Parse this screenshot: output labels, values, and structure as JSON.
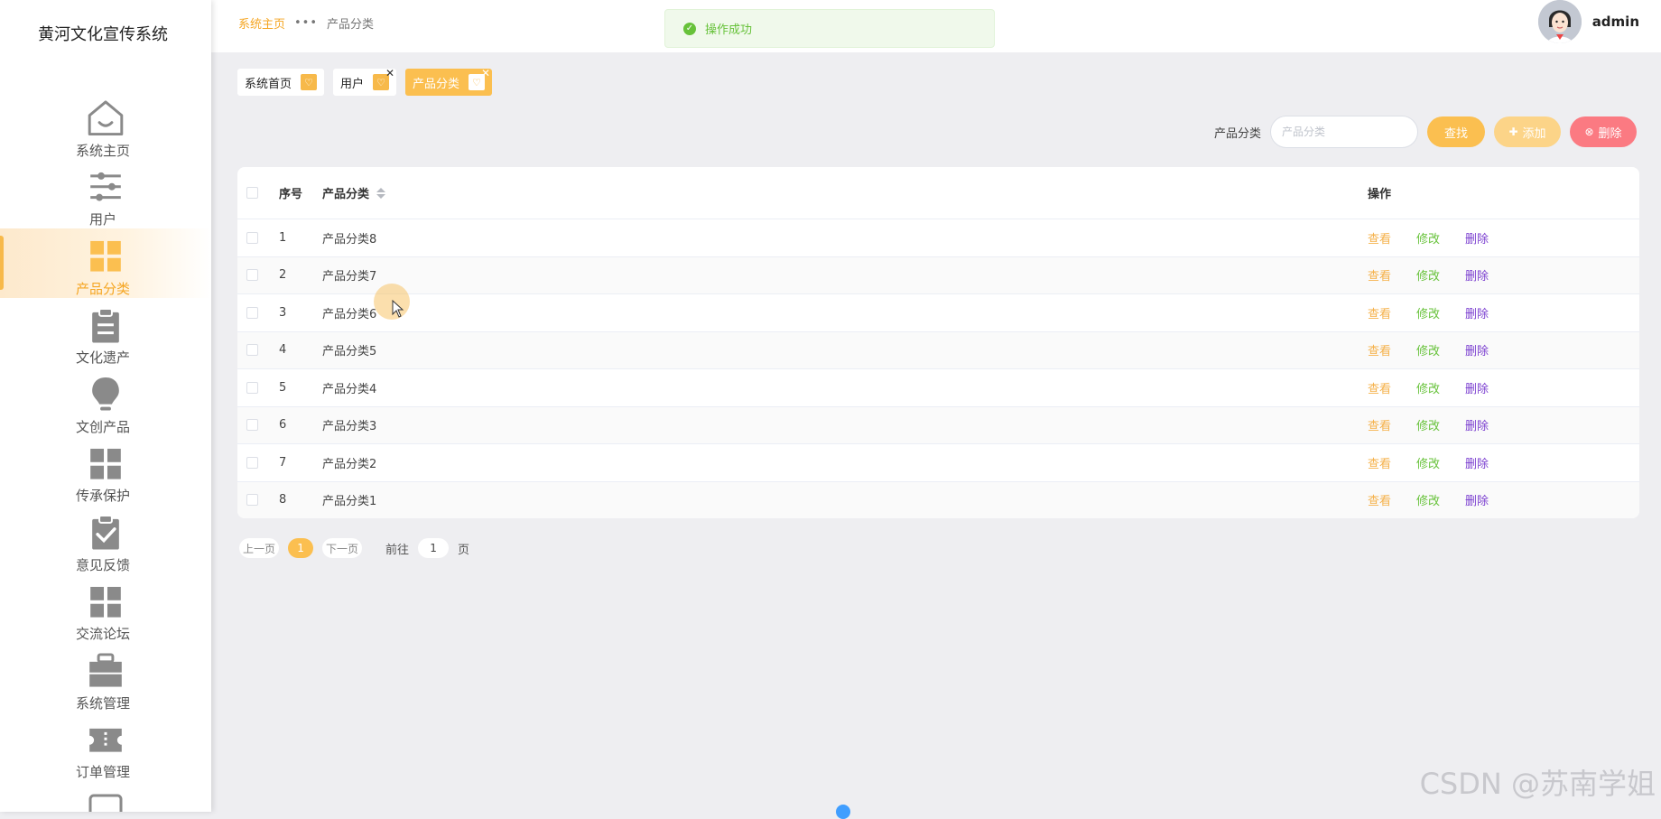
{
  "app": {
    "title": "黄河文化宣传系统"
  },
  "sidebar": {
    "items": [
      {
        "label": "系统主页",
        "icon": "home-icon"
      },
      {
        "label": "用户",
        "icon": "sliders-icon"
      },
      {
        "label": "产品分类",
        "icon": "grid-icon",
        "active": true
      },
      {
        "label": "文化遗产",
        "icon": "clipboard-icon"
      },
      {
        "label": "文创产品",
        "icon": "bulb-icon"
      },
      {
        "label": "传承保护",
        "icon": "grid-icon"
      },
      {
        "label": "意见反馈",
        "icon": "clipboard-check-icon"
      },
      {
        "label": "交流论坛",
        "icon": "grid-icon"
      },
      {
        "label": "系统管理",
        "icon": "briefcase-icon"
      },
      {
        "label": "订单管理",
        "icon": "ticket-icon"
      }
    ]
  },
  "header": {
    "breadcrumb": {
      "home": "系统主页",
      "separator": "•••",
      "current": "产品分类"
    },
    "toast": "操作成功",
    "user": {
      "name": "admin"
    }
  },
  "tags": [
    {
      "label": "系统首页",
      "closable": false
    },
    {
      "label": "用户",
      "closable": true
    },
    {
      "label": "产品分类",
      "closable": true,
      "active": true
    }
  ],
  "search": {
    "label": "产品分类",
    "placeholder": "产品分类",
    "find_label": "查找",
    "add_label": "添加",
    "delete_label": "删除"
  },
  "table": {
    "headers": {
      "no": "序号",
      "name": "产品分类",
      "ops": "操作"
    },
    "rows": [
      {
        "no": "1",
        "name": "产品分类8"
      },
      {
        "no": "2",
        "name": "产品分类7"
      },
      {
        "no": "3",
        "name": "产品分类6"
      },
      {
        "no": "4",
        "name": "产品分类5"
      },
      {
        "no": "5",
        "name": "产品分类4"
      },
      {
        "no": "6",
        "name": "产品分类3"
      },
      {
        "no": "7",
        "name": "产品分类2"
      },
      {
        "no": "8",
        "name": "产品分类1"
      }
    ],
    "ops": {
      "view": "查看",
      "edit": "修改",
      "delete": "删除"
    }
  },
  "pager": {
    "prev": "上一页",
    "current": "1",
    "next": "下一页",
    "goto": "前往",
    "goto_value": "1",
    "page_unit": "页"
  },
  "watermark": "CSDN @苏南学姐",
  "colors": {
    "accent": "#fbbf50",
    "success": "#67c23a",
    "danger": "#fb7a82",
    "purple": "#7b3fd0",
    "icon_gray": "#8a8a8a"
  }
}
